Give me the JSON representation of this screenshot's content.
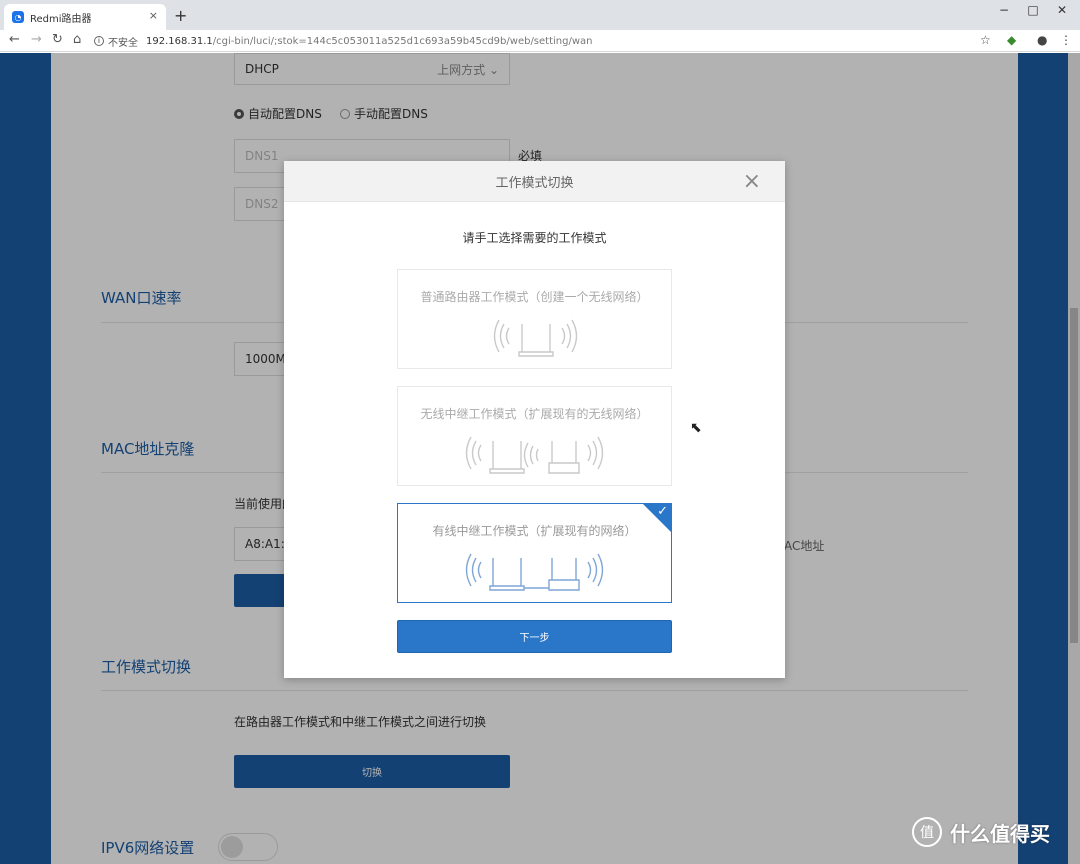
{
  "browser": {
    "tab_title": "Redmi路由器",
    "tab_close": "×",
    "new_tab": "+",
    "win_min": "−",
    "win_max": "□",
    "win_close": "✕",
    "back": "←",
    "forward": "→",
    "reload": "↻",
    "home": "⌂",
    "security_label": "不安全",
    "url_host": "192.168.31.1",
    "url_path": "/cgi-bin/luci/;stok=144c5c053011a525d1c693a59b45cd9b/web/setting/wan",
    "star": "☆",
    "account": "●",
    "menu": "⋮"
  },
  "page": {
    "connection_value": "DHCP",
    "connection_label": "上网方式",
    "dns_auto": "自动配置DNS",
    "dns_manual": "手动配置DNS",
    "dns1_placeholder": "DNS1",
    "dns2_placeholder": "DNS2",
    "required": "必填",
    "wan_speed_title": "WAN口速率",
    "wan_speed_value": "1000M/",
    "mac_clone_title": "MAC地址克隆",
    "mac_current_label": "当前使用的",
    "mac_value": "A8:A1:5",
    "mac_suffix": "AC地址",
    "mode_title": "工作模式切换",
    "mode_desc": "在路由器工作模式和中继工作模式之间进行切换",
    "switch_button": "切换",
    "ipv6_title": "IPV6网络设置"
  },
  "modal": {
    "title": "工作模式切换",
    "close": "×",
    "subtitle": "请手工选择需要的工作模式",
    "options": [
      {
        "label": "普通路由器工作模式（创建一个无线网络）",
        "selected": false
      },
      {
        "label": "无线中继工作模式（扩展现有的无线网络）",
        "selected": false
      },
      {
        "label": "有线中继工作模式（扩展现有的网络）",
        "selected": true
      }
    ],
    "check": "✓",
    "next_button": "下一步"
  },
  "watermark": {
    "logo": "值",
    "text": "什么值得买"
  },
  "colors": {
    "brand_blue": "#1d5ea6",
    "accent_blue": "#2a77c9"
  }
}
